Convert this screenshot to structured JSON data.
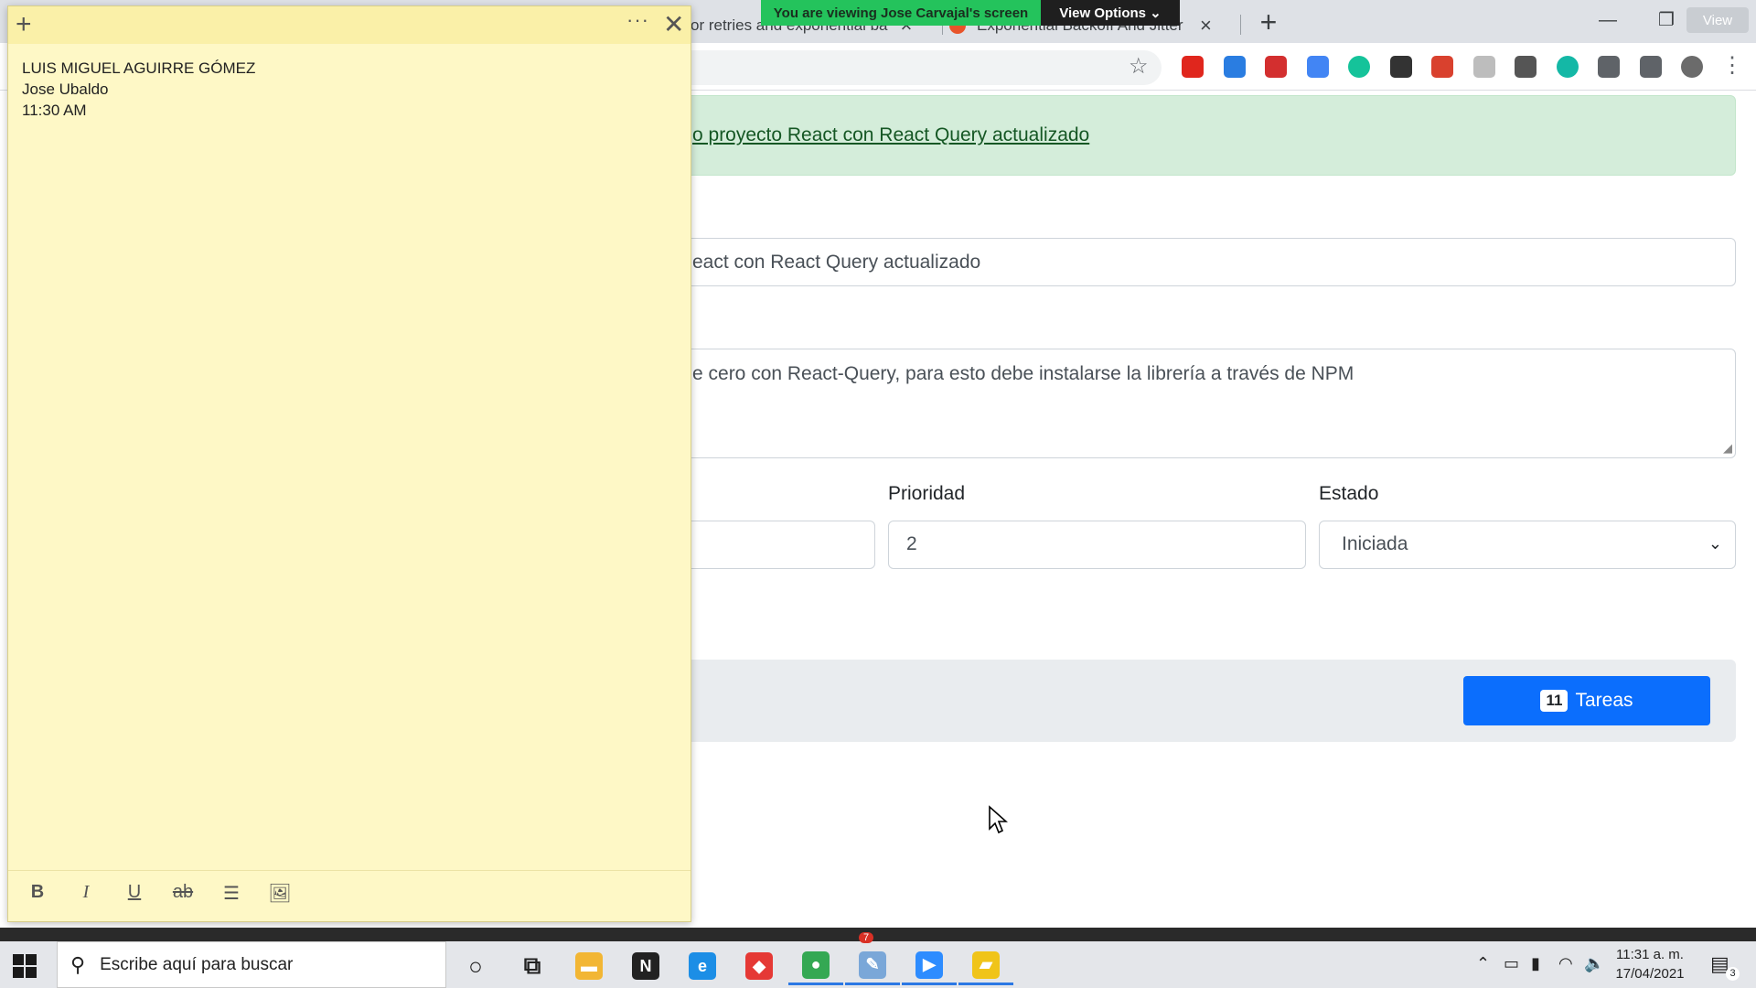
{
  "browser": {
    "tabs": [
      {
        "title": "or retries and exponential ba",
        "close": "×"
      },
      {
        "title": "Exponential Backoff And Jitter | A",
        "close": "×"
      }
    ],
    "new_tab": "+",
    "share_banner": {
      "viewing": "You are viewing Jose Carvajal's screen",
      "options": "View Options ⌄"
    },
    "view_chip": "View",
    "window_controls": {
      "minimize": "—",
      "restore": "❐",
      "close": "✕"
    },
    "star": "☆",
    "menu": "⋮",
    "extensions": [
      {
        "name": "opera-ext-icon",
        "color": "#e0261d"
      },
      {
        "name": "screen-ext-icon",
        "color": "#2a7de1"
      },
      {
        "name": "cors-ext-icon",
        "color": "#d32f2f"
      },
      {
        "name": "translate-ext-icon",
        "color": "#4285f4"
      },
      {
        "name": "grammarly-ext-icon",
        "color": "#15c39a"
      },
      {
        "name": "block-ext-icon",
        "color": "#333333"
      },
      {
        "name": "puzzle-red-ext-icon",
        "color": "#d9412e"
      },
      {
        "name": "gray-ext-icon",
        "color": "#bdbdbd"
      },
      {
        "name": "eyedropper-ext-icon",
        "color": "#555555"
      },
      {
        "name": "m-ext-icon",
        "color": "#14b8a6"
      },
      {
        "name": "extensions-icon",
        "color": "#5f6368"
      },
      {
        "name": "cast-icon",
        "color": "#5f6368"
      },
      {
        "name": "profile-avatar-icon",
        "color": "#6b6b6b"
      }
    ]
  },
  "page": {
    "alert_link": "o proyecto React con React Query actualizado",
    "title_value": "eact con React Query actualizado",
    "description_value": "e cero con React-Query, para esto debe instalarse la librería a través de NPM",
    "priority_label": "Prioridad",
    "priority_value": "2",
    "status_label": "Estado",
    "status_value": "Iniciada",
    "tasks_button": {
      "count": "11",
      "label": "Tareas"
    },
    "accent": "#0b6efd"
  },
  "sticky_note": {
    "add": "+",
    "more": "···",
    "close": "✕",
    "lines": [
      "LUIS MIGUEL AGUIRRE GÓMEZ",
      "Jose Ubaldo",
      "11:30 AM"
    ],
    "format": {
      "bold": "B",
      "italic": "I",
      "underline": "U",
      "strike": "ab",
      "list": "☰",
      "image": "🖼"
    },
    "color": "#fef8c6"
  },
  "taskbar": {
    "search_placeholder": "Escribe aquí para buscar",
    "apps": [
      {
        "name": "cortana-icon",
        "glyph": "○",
        "color": "#222222",
        "active": false
      },
      {
        "name": "task-view-icon",
        "glyph": "⧉",
        "color": "#222222",
        "active": false
      },
      {
        "name": "file-explorer-icon",
        "glyph": "▬",
        "color": "#f2b634",
        "active": false
      },
      {
        "name": "notion-icon",
        "glyph": "N",
        "color": "#222222",
        "active": false
      },
      {
        "name": "edge-icon",
        "glyph": "e",
        "color": "#1c8ee6",
        "active": false
      },
      {
        "name": "anydesk-icon",
        "glyph": "◆",
        "color": "#e53935",
        "active": false
      },
      {
        "name": "chrome-icon",
        "glyph": "●",
        "color": "#34a853",
        "active": true
      },
      {
        "name": "paint-icon",
        "glyph": "✎",
        "color": "#7aa7d8",
        "active": true
      },
      {
        "name": "zoom-icon",
        "glyph": "▶",
        "color": "#2d8cff",
        "active": true
      },
      {
        "name": "sticky-notes-icon",
        "glyph": "▰",
        "color": "#f0c419",
        "active": true
      }
    ],
    "clock_time": "11:31 a. m.",
    "clock_date": "17/04/2021",
    "notification_count": "3",
    "chrome_badge": "7"
  }
}
